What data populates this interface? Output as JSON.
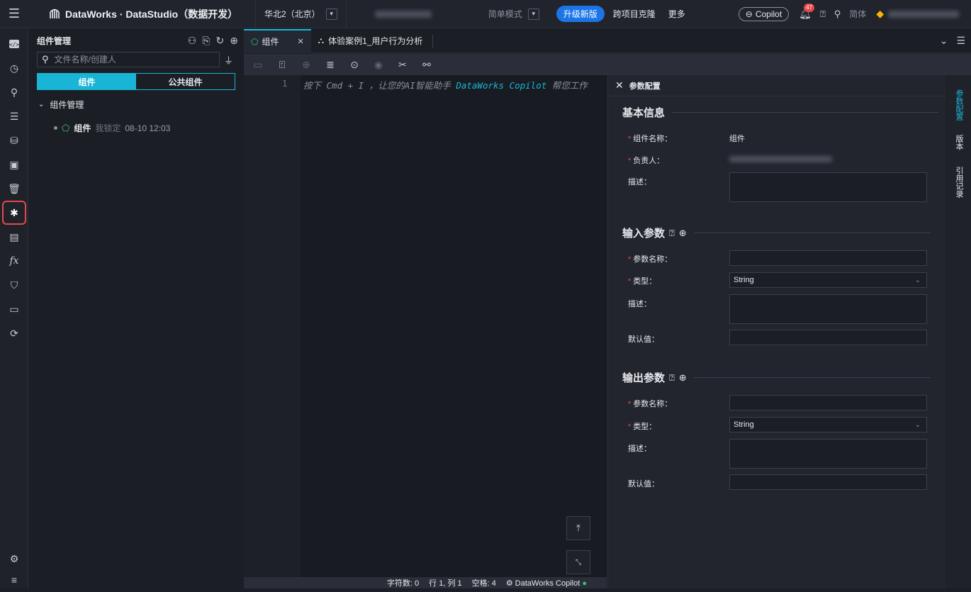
{
  "topbar": {
    "app_title": "DataWorks · DataStudio（数据开发）",
    "region": "华北2（北京）",
    "mode": "简单模式",
    "upgrade": "升级新版",
    "cross_project": "跨项目克隆",
    "more": "更多",
    "copilot": "Copilot",
    "notification_count": "47",
    "lang": "简体"
  },
  "rail": {
    "items": [
      "code-icon",
      "clock-icon",
      "search-icon",
      "list-icon",
      "database-icon",
      "briefcase-icon",
      "trash-icon",
      "component-icon",
      "table-icon",
      "function-icon",
      "shield-icon",
      "report-icon",
      "analysis-icon"
    ],
    "bottom": [
      "settings-icon",
      "menu-icon"
    ],
    "function_label": "fx"
  },
  "sidebar": {
    "title": "组件管理",
    "search_placeholder": "文件名称/创建人",
    "seg_components": "组件",
    "seg_public": "公共组件",
    "tree_root": "组件管理",
    "leaf_name": "组件",
    "leaf_lock": "我锁定",
    "leaf_time": "08-10 12:03"
  },
  "tabs": {
    "tab1": "组件",
    "tab2": "体验案例1_用户行为分析"
  },
  "editor": {
    "line_number": "1",
    "hint_prefix": "按下 Cmd + I ，让您的AI智能助手 ",
    "hint_brand": "DataWorks Copilot",
    "hint_suffix": " 帮您工作"
  },
  "statusbar": {
    "chars": "字符数: 0",
    "pos": "行 1, 列 1",
    "spaces": "空格: 4",
    "copilot": "DataWorks Copilot"
  },
  "panel": {
    "title": "参数配置",
    "basic": "基本信息",
    "name_label": "组件名称：",
    "name_value": "组件",
    "owner_label": "负责人：",
    "desc_label": "描述：",
    "input_params": "输入参数",
    "output_params": "输出参数",
    "param_name_label": "参数名称：",
    "type_label": "类型：",
    "type_value": "String",
    "default_label": "默认值："
  },
  "vtabs": {
    "params": "参数配置",
    "version": "版本",
    "refs": "引用记录"
  }
}
